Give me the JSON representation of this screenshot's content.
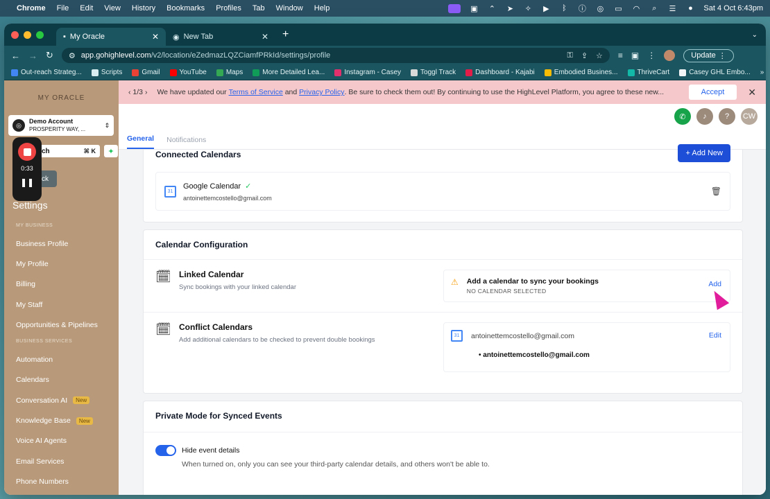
{
  "menubar": {
    "app": "Chrome",
    "items": [
      "File",
      "Edit",
      "View",
      "History",
      "Bookmarks",
      "Profiles",
      "Tab",
      "Window",
      "Help"
    ],
    "clock": "Sat 4 Oct  6:43pm"
  },
  "browser": {
    "tabs": [
      {
        "label": "My Oracle",
        "active": true
      },
      {
        "label": "New Tab",
        "active": false
      }
    ],
    "url_host": "app.gohighlevel.com",
    "url_path": "/v2/location/eZedmazLQZCiamfPRkId/settings/profile",
    "update_label": "Update",
    "bookmarks": [
      {
        "label": "Out-reach Strateg...",
        "color": "#4285f4"
      },
      {
        "label": "Scripts",
        "color": "#d9eef0"
      },
      {
        "label": "Gmail",
        "color": "#ea4335"
      },
      {
        "label": "YouTube",
        "color": "#ff0000"
      },
      {
        "label": "Maps",
        "color": "#34a853"
      },
      {
        "label": "More Detailed Lea...",
        "color": "#0f9d58"
      },
      {
        "label": "Instagram - Casey",
        "color": "#e1306c"
      },
      {
        "label": "Toggl Track",
        "color": "#d9d9d9"
      },
      {
        "label": "Dashboard - Kajabi",
        "color": "#e11d48"
      },
      {
        "label": "Embodied Busines...",
        "color": "#fbbc05"
      },
      {
        "label": "ThriveCart",
        "color": "#14b8a6"
      },
      {
        "label": "Casey GHL Embo...",
        "color": "#f3f4f6"
      }
    ]
  },
  "sidebar": {
    "logo": "MY ORACLE",
    "account_name": "Demo Account",
    "account_address": "PROSPERITY WAY, ...",
    "search_fragment": "ch",
    "search_shortcut": "⌘ K",
    "back_label": "ck",
    "recorder_time": "0:33",
    "settings_title": "Settings",
    "section_my_business": "MY BUSINESS",
    "section_business_services": "BUSINESS SERVICES",
    "my_business_items": [
      "Business Profile",
      "My Profile",
      "Billing",
      "My Staff",
      "Opportunities & Pipelines"
    ],
    "services_items": [
      "Automation",
      "Calendars",
      "Conversation AI",
      "Knowledge Base",
      "Voice AI Agents",
      "Email Services",
      "Phone Numbers"
    ],
    "new_badge": "New"
  },
  "banner": {
    "pager": "1/3",
    "text_1": "We have updated our",
    "tos": "Terms of Service",
    "text_2": "and",
    "privacy": "Privacy Policy",
    "text_3": ". Be sure to check them out! By continuing to use the HighLevel Platform, you agree to these new...",
    "accept": "Accept"
  },
  "topbar": {
    "avatar_initials": "CW"
  },
  "tabs": {
    "general": "General",
    "notifications": "Notifications"
  },
  "connected": {
    "title": "Connected Calendars",
    "add_new": "Add New",
    "provider": "Google Calendar",
    "email": "antoinettemcostello@gmail.com"
  },
  "config": {
    "title": "Calendar Configuration",
    "linked_title": "Linked Calendar",
    "linked_sub": "Sync bookings with your linked calendar",
    "linked_warning": "Add a calendar to sync your bookings",
    "linked_status": "NO CALENDAR SELECTED",
    "linked_action": "Add",
    "conflict_title": "Conflict Calendars",
    "conflict_sub": "Add additional calendars to be checked to prevent double bookings",
    "conflict_email": "antoinettemcostello@gmail.com",
    "conflict_item": "antoinettemcostello@gmail.com",
    "conflict_action": "Edit"
  },
  "privacy": {
    "title": "Private Mode for Synced Events",
    "toggle_label": "Hide event details",
    "toggle_on": true,
    "desc": "When turned on, only you can see your third-party calendar details, and others won't be able to."
  }
}
